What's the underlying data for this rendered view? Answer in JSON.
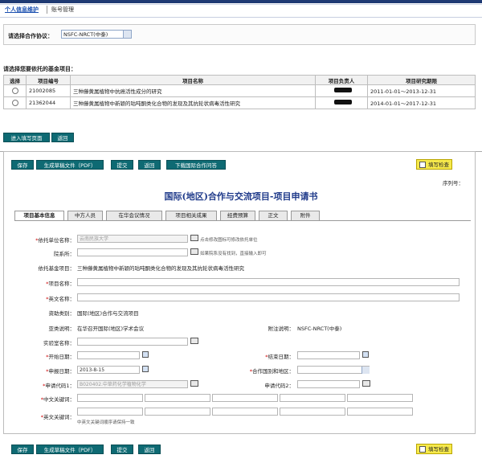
{
  "nav": {
    "tab_active": "个人信息维护",
    "tab_other": "账号管理"
  },
  "agreement": {
    "label": "请选择合作协议：",
    "value": "NSFC-NRCT(中泰)"
  },
  "projects": {
    "title": "请选择您要依托的基金项目：",
    "headers": [
      "选择",
      "项目编号",
      "项目名称",
      "项目负责人",
      "项目研究期限"
    ],
    "rows": [
      {
        "code": "21002085",
        "name": "三种藤黄属植物中抗癌活性成分的研究",
        "period": "2011-01-01～2013-12-31"
      },
      {
        "code": "21362044",
        "name": "三种藤黄属植物中新颖的咕吨酮类化合物的发现及其抗轮状病毒活性研究",
        "period": "2014-01-01～2017-12-31"
      }
    ]
  },
  "buttons": {
    "enter": "进入填写页面",
    "back": "返回",
    "save": "保存",
    "gen_pdf": "生成草稿文件（PDF）",
    "submit": "提交",
    "return": "返回",
    "download": "下载国际合作问答",
    "check": "填写检查"
  },
  "form": {
    "serial": "序列号：",
    "title": "国际(地区)合作与交流项目-项目申请书",
    "tabs": [
      "项目基本信息",
      "中方人员",
      "在华会议情况",
      "项目相关成果",
      "经费预算",
      "正文",
      "附件"
    ],
    "unit_label": "依托单位名称：",
    "unit_value": "云南民族大学",
    "unit_hint": "点击修改图标可修改依托单位",
    "dept_label": "院系所：",
    "dept_hint": "如果院系没有找到，直接输入即可",
    "fund_label": "依托基金项目：",
    "fund_value": "三种藤黄属植物中新颖的咕吨酮类化合物的发现及其抗轮状病毒活性研究",
    "name_label": "项目名称：",
    "ename_label": "英文名称：",
    "category_label": "资助类别：",
    "category_value": "国际(地区)合作与交流项目",
    "sub_label": "亚类说明：",
    "sub_value": "在华召开国际(地区)学术会议",
    "note_label": "附注说明：",
    "note_value": "NSFC-NRCT(中泰)",
    "lab_label": "实验室名称：",
    "start_label": "开始日期：",
    "end_label": "结束日期：",
    "apply_label": "申报日期：",
    "apply_value": "2013-8-15",
    "country_label": "合作国别和地区：",
    "code1_label": "申请代码1：",
    "code1_value": "B020402.中草药化学植物化学",
    "code2_label": "申请代码2：",
    "kw_label": "中文关键词：",
    "ekw_label": "英文关键词：",
    "kw_hint": "中英文关键词顺序请保持一致"
  }
}
